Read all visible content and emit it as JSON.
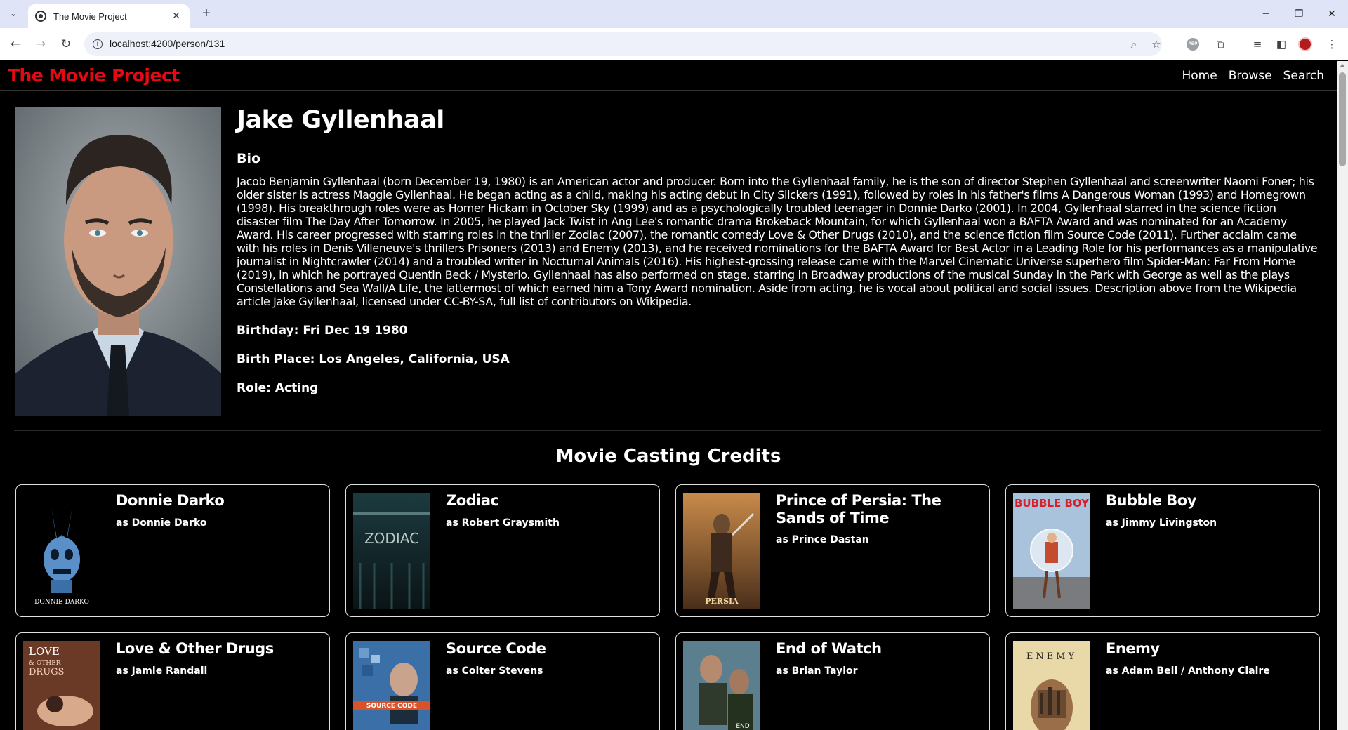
{
  "browser": {
    "tab_title": "The Movie Project",
    "url": "localhost:4200/person/131"
  },
  "site": {
    "brand": "The Movie Project",
    "nav": [
      "Home",
      "Browse",
      "Search"
    ]
  },
  "person": {
    "name": "Jake Gyllenhaal",
    "bio_heading": "Bio",
    "bio": "Jacob Benjamin Gyllenhaal (born December 19, 1980) is an American actor and producer. Born into the Gyllenhaal family, he is the son of director Stephen Gyllenhaal and screenwriter Naomi Foner; his older sister is actress Maggie Gyllenhaal. He began acting as a child, making his acting debut in City Slickers (1991), followed by roles in his father's films A Dangerous Woman (1993) and Homegrown (1998). His breakthrough roles were as Homer Hickam in October Sky (1999) and as a psychologically troubled teenager in Donnie Darko (2001). In 2004, Gyllenhaal starred in the science fiction disaster film The Day After Tomorrow. In 2005, he played Jack Twist in Ang Lee's romantic drama Brokeback Mountain, for which Gyllenhaal won a BAFTA Award and was nominated for an Academy Award. His career progressed with starring roles in the thriller Zodiac (2007), the romantic comedy Love & Other Drugs (2010), and the science fiction film Source Code (2011). Further acclaim came with his roles in Denis Villeneuve's thrillers Prisoners (2013) and Enemy (2013), and he received nominations for the BAFTA Award for Best Actor in a Leading Role for his performances as a manipulative journalist in Nightcrawler (2014) and a troubled writer in Nocturnal Animals (2016). His highest-grossing release came with the Marvel Cinematic Universe superhero film Spider-Man: Far From Home (2019), in which he portrayed Quentin Beck / Mysterio. Gyllenhaal has also performed on stage, starring in Broadway productions of the musical Sunday in the Park with George as well as the plays Constellations and Sea Wall/A Life, the lattermost of which earned him a Tony Award nomination. Aside from acting, he is vocal about political and social issues. Description above from the Wikipedia article Jake Gyllenhaal, licensed under CC-BY-SA, full list of contributors on Wikipedia.",
    "birthday": "Birthday: Fri Dec 19 1980",
    "birth_place": "Birth Place: Los Angeles, California, USA",
    "role": "Role: Acting"
  },
  "credits": {
    "heading": "Movie Casting Credits",
    "items": [
      {
        "title": "Donnie Darko",
        "character": "as Donnie Darko",
        "poster_text": "DONNIE DARKO"
      },
      {
        "title": "Zodiac",
        "character": "as Robert Graysmith",
        "poster_text": "ZODIAC"
      },
      {
        "title": "Prince of Persia: The Sands of Time",
        "character": "as Prince Dastan",
        "poster_text": "PERSIA"
      },
      {
        "title": "Bubble Boy",
        "character": "as Jimmy Livingston",
        "poster_text": "BUBBLE BOY"
      },
      {
        "title": "Love & Other Drugs",
        "character": "as Jamie Randall",
        "poster_text": "LOVE & OTHER DRUGS"
      },
      {
        "title": "Source Code",
        "character": "as Colter Stevens",
        "poster_text": "SOURCE CODE"
      },
      {
        "title": "End of Watch",
        "character": "as Brian Taylor",
        "poster_text": "END WATCH"
      },
      {
        "title": "Enemy",
        "character": "as Adam Bell / Anthony Claire",
        "poster_text": "ENEMY"
      }
    ]
  }
}
